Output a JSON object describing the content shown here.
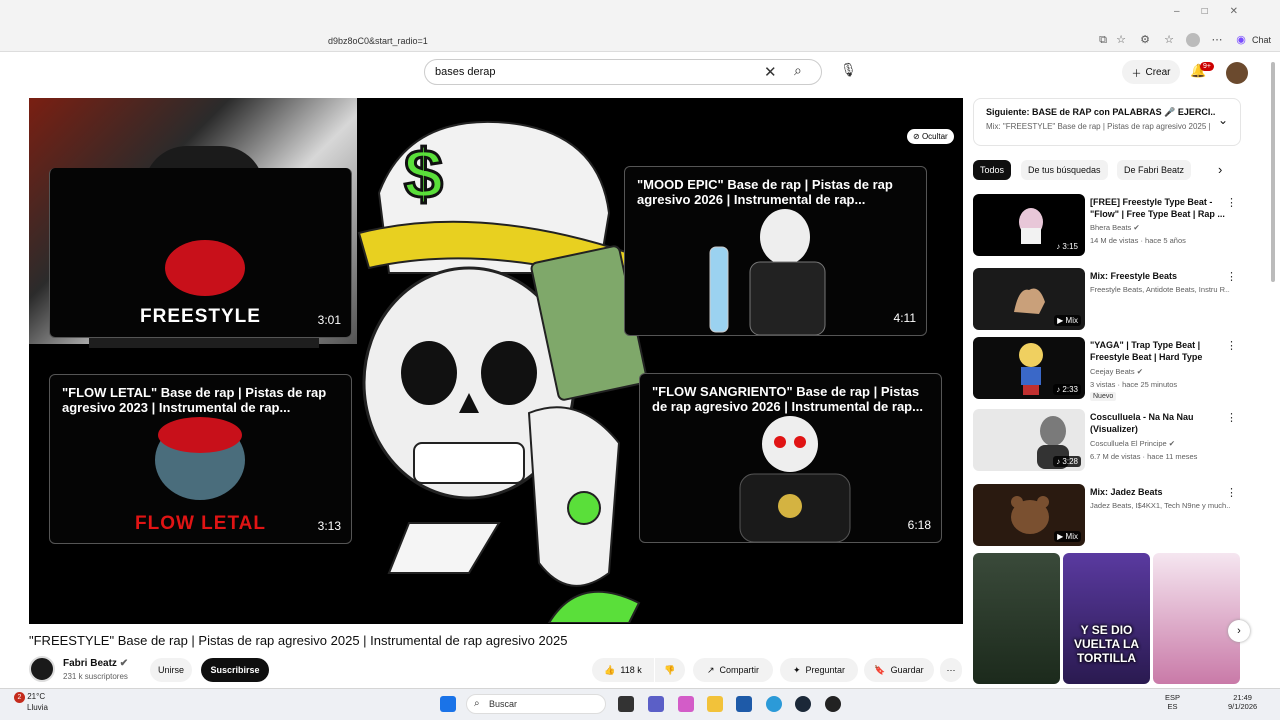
{
  "browser": {
    "url": "d9bz8oC0&start_radio=1",
    "chat_label": "Chat"
  },
  "header": {
    "search_value": "bases derap",
    "crear_label": "Crear",
    "notif_count": "9+"
  },
  "player": {
    "ocultar_label": "Ocultar",
    "end_cards": [
      {
        "title": "",
        "big_text": "FREESTYLE",
        "big_color": "#ffffff",
        "duration": "3:01"
      },
      {
        "title": "\"MOOD EPIC\" Base de rap | Pistas de rap agresivo 2026 | Instrumental de rap...",
        "duration": "4:11"
      },
      {
        "title": "\"FLOW LETAL\" Base de rap | Pistas de rap agresivo 2023 | Instrumental de rap...",
        "big_text": "FLOW LETAL",
        "big_color": "#e01414",
        "duration": "3:13"
      },
      {
        "title": "\"FLOW SANGRIENTO\" Base de rap | Pistas de rap agresivo 2026 | Instrumental de rap...",
        "duration": "6:18"
      }
    ]
  },
  "video": {
    "title": "\"FREESTYLE\" Base de rap | Pistas de rap agresivo 2025 | Instrumental de rap agresivo 2025",
    "channel": "Fabri Beatz",
    "subscribers": "231 k suscriptores",
    "join_label": "Unirse",
    "subscribe_label": "Suscribirse",
    "likes": "118 k",
    "share_label": "Compartir",
    "ask_label": "Preguntar",
    "save_label": "Guardar"
  },
  "sidebar": {
    "next_title": "Siguiente: BASE de RAP con PALABRAS 🎤 EJERCI...",
    "next_sub": "Mix: \"FREESTYLE\" Base de rap | Pistas de rap agresivo 2025 |",
    "chips": [
      "Todos",
      "De tus búsquedas",
      "De Fabri Beatz"
    ],
    "videos": [
      {
        "title": "[FREE] Freestyle Type Beat - \"Flow\" | Free Type Beat | Rap ...",
        "meta1": "Bhera Beats ✔",
        "meta2": "14 M de vistas · hace 5 años",
        "duration": "♪ 3:15",
        "color": "#000000"
      },
      {
        "title": "Mix: Freestyle Beats",
        "meta1": "Freestyle Beats, Antidote Beats, Instru R...",
        "meta2": "",
        "duration": "▶ Mix",
        "color": "#1a1a1a"
      },
      {
        "title": "\"YAGA\" | Trap Type Beat | Freestyle Beat | Hard Type Bea...",
        "meta1": "Ceejay Beats ✔",
        "meta2": "3 vistas · hace 25 minutos",
        "duration": "♪ 2:33",
        "color": "#0c0c0c",
        "badge": "Nuevo"
      },
      {
        "title": "Cosculluela - Na Na Nau (Visualizer)",
        "meta1": "Cosculluela El Principe ✔",
        "meta2": "6.7 M de vistas · hace 11 meses",
        "duration": "♪ 3:28",
        "color": "#e8e8e8"
      },
      {
        "title": "Mix: Jadez Beats",
        "meta1": "Jadez Beats, I$4KX1, Tech N9ne y much...",
        "meta2": "",
        "duration": "▶ Mix",
        "color": "#2a1a10"
      }
    ],
    "short_caption": "Y SE DIO VUELTA LA TORTILLA"
  },
  "taskbar": {
    "temp": "21°C",
    "weather": "Lluvia",
    "weather_badge": "2",
    "search_label": "Buscar",
    "lang1": "ESP",
    "lang2": "ES",
    "time": "21:49",
    "date": "9/1/2026"
  }
}
